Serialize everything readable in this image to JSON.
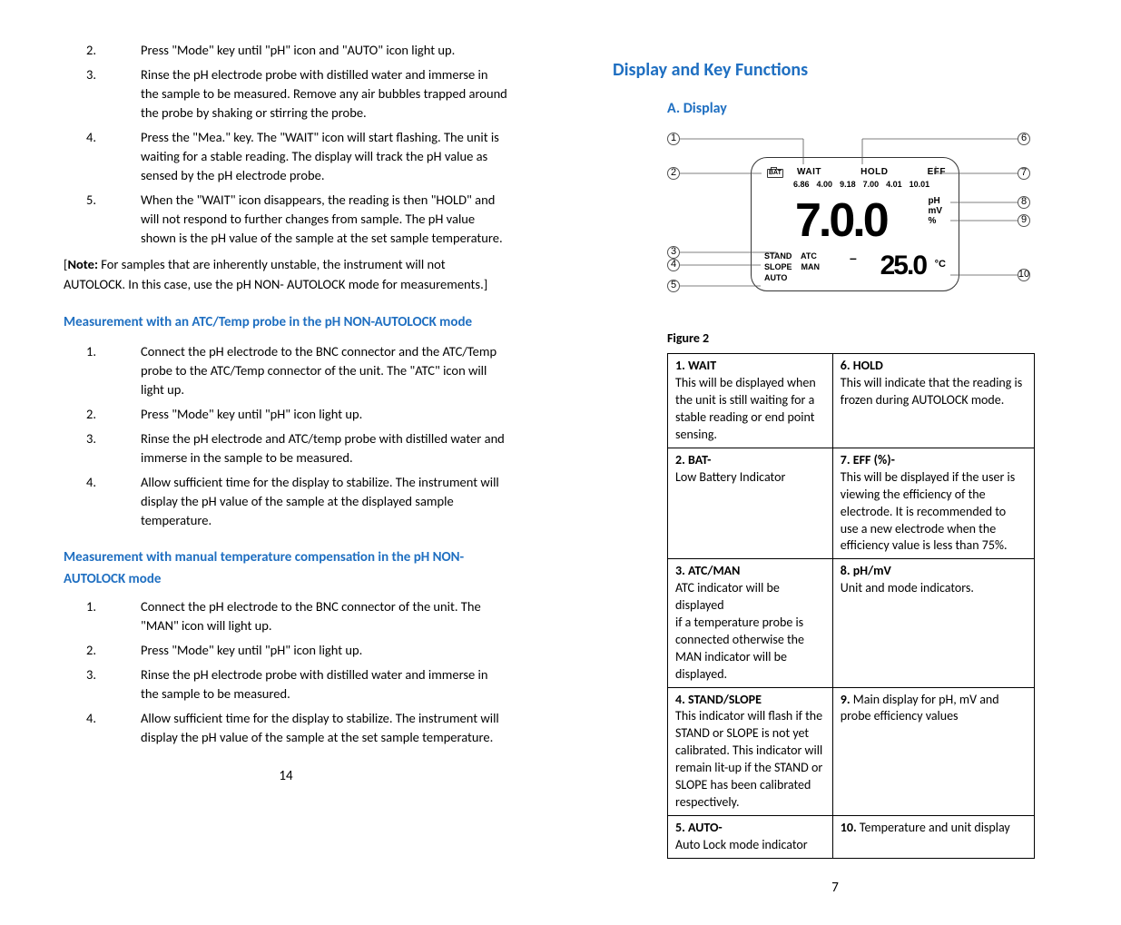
{
  "left": {
    "list1": [
      {
        "n": "2.",
        "t": "Press \"Mode\" key until \"pH\" icon and \"AUTO\" icon light up."
      },
      {
        "n": "3.",
        "t": "Rinse the pH electrode probe with distilled water and immerse in the sample to be measured. Remove any air bubbles trapped around the probe by shaking or stirring the probe."
      },
      {
        "n": "4.",
        "t": "Press the \"Mea.\" key. The \"WAIT\" icon will start flashing. The unit is waiting for a stable reading. The display will track the pH value as sensed by the pH electrode probe."
      },
      {
        "n": "5.",
        "t": "When the \"WAIT\" icon disappears, the reading is then \"HOLD\" and will not respond to further changes from sample. The pH value shown is the pH value of the sample at the set sample temperature."
      }
    ],
    "note_label": "Note:",
    "note": " For samples that are inherently unstable, the instrument will not AUTOLOCK. In this case, use the pH NON- AUTOLOCK mode for measurements.]",
    "h1": "Measurement with an ATC/Temp probe in the pH NON-AUTOLOCK mode",
    "list2": [
      {
        "n": "1.",
        "t": "Connect the pH electrode to the BNC connector and the ATC/Temp probe to the ATC/Temp connector of the unit. The \"ATC\" icon will light up."
      },
      {
        "n": "2.",
        "t": "Press \"Mode\" key until \"pH\" icon light up."
      },
      {
        "n": "3.",
        "t": "Rinse the pH electrode and ATC/temp probe with distilled water and immerse in the sample to be measured."
      },
      {
        "n": "4.",
        "t": "Allow sufficient time for the display to stabilize. The instrument will display the pH value of the sample at the displayed sample temperature."
      }
    ],
    "h2": "Measurement with manual temperature compensation in the pH NON-AUTOLOCK mode",
    "list3": [
      {
        "n": "1.",
        "t": "Connect the pH electrode to the BNC connector of the unit. The \"MAN\" icon will light up."
      },
      {
        "n": "2.",
        "t": "Press \"Mode\" key until \"pH\" icon light up."
      },
      {
        "n": "3.",
        "t": "Rinse the pH electrode probe with distilled water and immerse in the sample to be measured."
      },
      {
        "n": "4.",
        "t": "Allow sufficient time for the display to stabilize. The instrument will display the pH value of the sample at the set sample temperature."
      }
    ],
    "page": "14"
  },
  "right": {
    "main": "Display and Key Functions",
    "sub": "A. Display",
    "lcd": {
      "wait": "WAIT",
      "hold": "HOLD",
      "eff": "EFF",
      "bat": "BAT",
      "buf": [
        "6.86",
        "4.00",
        "9.18",
        "7.00",
        "4.01",
        "10.01"
      ],
      "big": "7.0.0",
      "ph": "pH",
      "mv": "mV",
      "pct": "%",
      "row3a": "STAND    ATC",
      "row3b": "SLOPE    MAN",
      "row3c": "AUTO",
      "neg": "–",
      "temp": "25.0",
      "degc": "°C"
    },
    "callouts": [
      "1",
      "2",
      "3",
      "4",
      "5",
      "6",
      "7",
      "8",
      "9",
      "10"
    ],
    "figlabel": "Figure 2",
    "table": [
      {
        "lh": "1. WAIT",
        "lb": "This will be displayed when the unit is still waiting for a stable reading or end point sensing.",
        "rh": "6. HOLD",
        "rb": "This will indicate that the reading is frozen during AUTOLOCK mode."
      },
      {
        "lh": "2. BAT-",
        "lb": "Low Battery Indicator",
        "rh": "7. EFF (%)-",
        "rb": "This will be displayed if the user is viewing the efficiency of the electrode. It is recommended to use a new electrode when the efficiency value is less than 75%."
      },
      {
        "lh": "3. ATC/MAN",
        "lb": "ATC indicator will be displayed\nif a temperature probe is connected otherwise the MAN indicator will be displayed.",
        "rh": "8. pH/mV",
        "rb": "Unit and mode indicators."
      },
      {
        "lh": "4. STAND/SLOPE",
        "lb": "This indicator will flash if the STAND or SLOPE is not yet calibrated. This indicator will remain lit-up if the STAND or SLOPE has been calibrated respectively.",
        "rh": "9.",
        "rb": " Main display for pH, mV and probe efficiency values"
      },
      {
        "lh": "5. AUTO-",
        "lb": "Auto Lock mode indicator",
        "rh": "10.",
        "rb": " Temperature and unit display"
      }
    ],
    "page": "7"
  }
}
